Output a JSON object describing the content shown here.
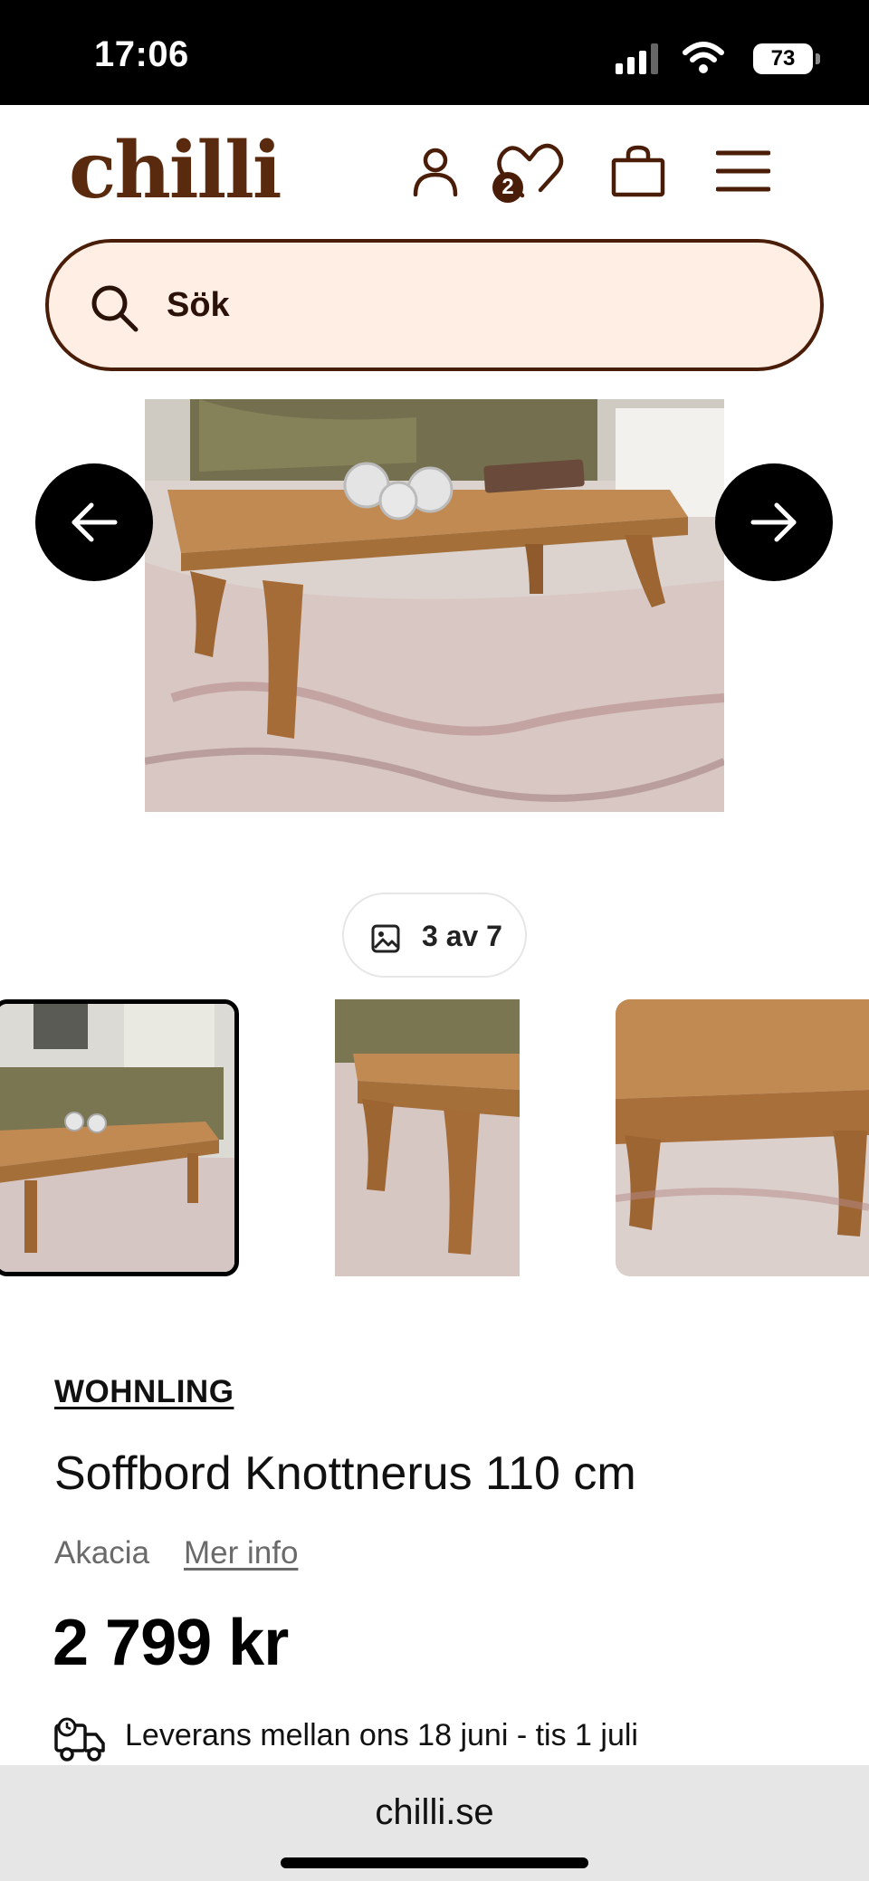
{
  "status_bar": {
    "time": "17:06",
    "battery": "73",
    "icons": [
      "signal-icon",
      "wifi-icon",
      "battery-icon"
    ]
  },
  "header": {
    "logo": "chilli",
    "wishlist_count": "2",
    "icons": [
      "account-icon",
      "wishlist-heart-icon",
      "cart-bag-icon",
      "menu-hamburger-icon"
    ]
  },
  "search": {
    "placeholder": "Sök"
  },
  "gallery": {
    "counter": "3 av 7",
    "prev_icon": "arrow-left-icon",
    "next_icon": "arrow-right-icon"
  },
  "product": {
    "brand": "WOHNLING",
    "title": "Soffbord Knottnerus 110 cm",
    "material": "Akacia",
    "more_info": "Mer info",
    "price": "2 799 kr",
    "delivery": "Leverans mellan ons 18 juni - tis 1 juli"
  },
  "browser": {
    "url": "chilli.se"
  },
  "colors": {
    "brand_brown": "#5a2a0f",
    "search_bg": "#ffeee4",
    "search_border": "#4a1d08"
  }
}
